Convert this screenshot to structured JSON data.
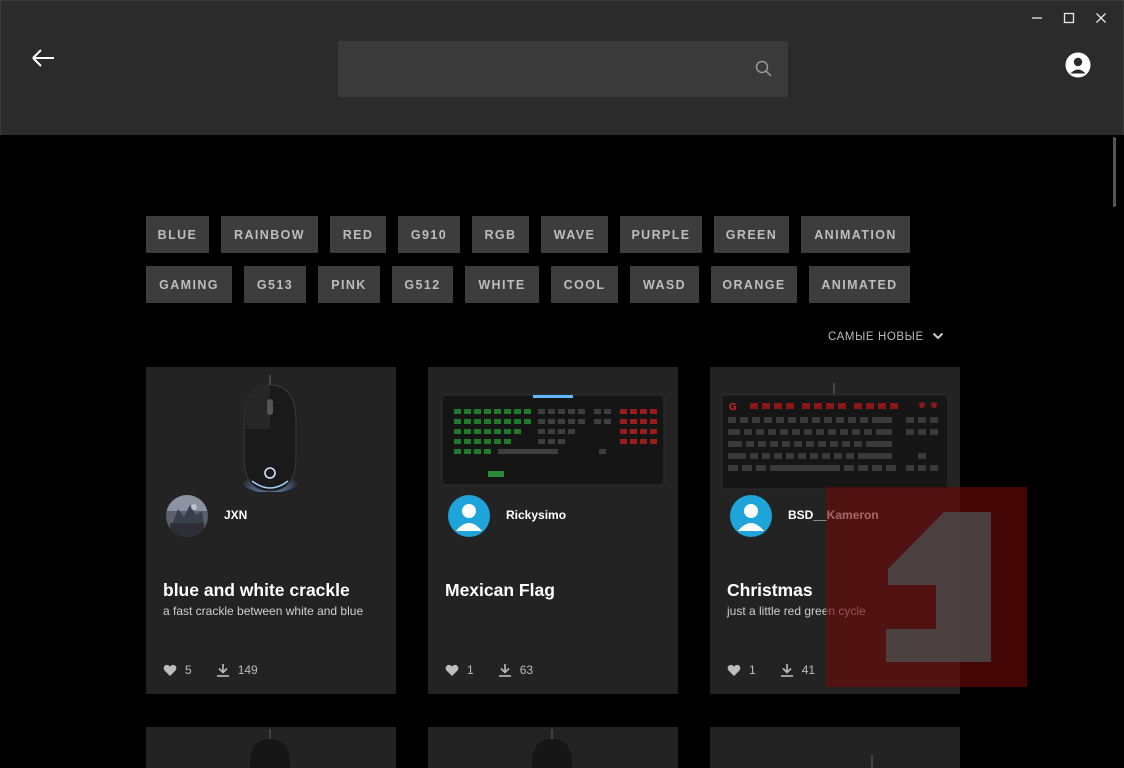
{
  "search": {
    "placeholder": ""
  },
  "window_controls": [
    "minimize",
    "maximize",
    "close"
  ],
  "tags": {
    "row1": [
      "BLUE",
      "RAINBOW",
      "RED",
      "G910",
      "RGB",
      "WAVE",
      "PURPLE",
      "GREEN",
      "ANIMATION"
    ],
    "row2": [
      "GAMING",
      "G513",
      "PINK",
      "G512",
      "WHITE",
      "COOL",
      "WASD",
      "ORANGE",
      "ANIMATED"
    ]
  },
  "sort": {
    "label": "САМЫЕ НОВЫЕ"
  },
  "cards": [
    {
      "username": "JXN",
      "title": "blue and white crackle",
      "description": "a fast crackle between white and blue",
      "likes": "5",
      "downloads": "149",
      "image": "mouse-icon"
    },
    {
      "username": "Rickysimo",
      "title": "Mexican Flag",
      "description": "",
      "likes": "1",
      "downloads": "63",
      "image": "keyboard-green-icon"
    },
    {
      "username": "BSD__Kameron",
      "title": "Christmas",
      "description": "just a little red green cycle",
      "likes": "1",
      "downloads": "41",
      "image": "keyboard-red-icon"
    }
  ],
  "colors": {
    "titlebar": "#2b2b2b",
    "background": "#000000",
    "card": "#232323",
    "tag": "#3d3d3d",
    "avatar_default": "#1ea4d8",
    "overlay": "#6e0808"
  }
}
